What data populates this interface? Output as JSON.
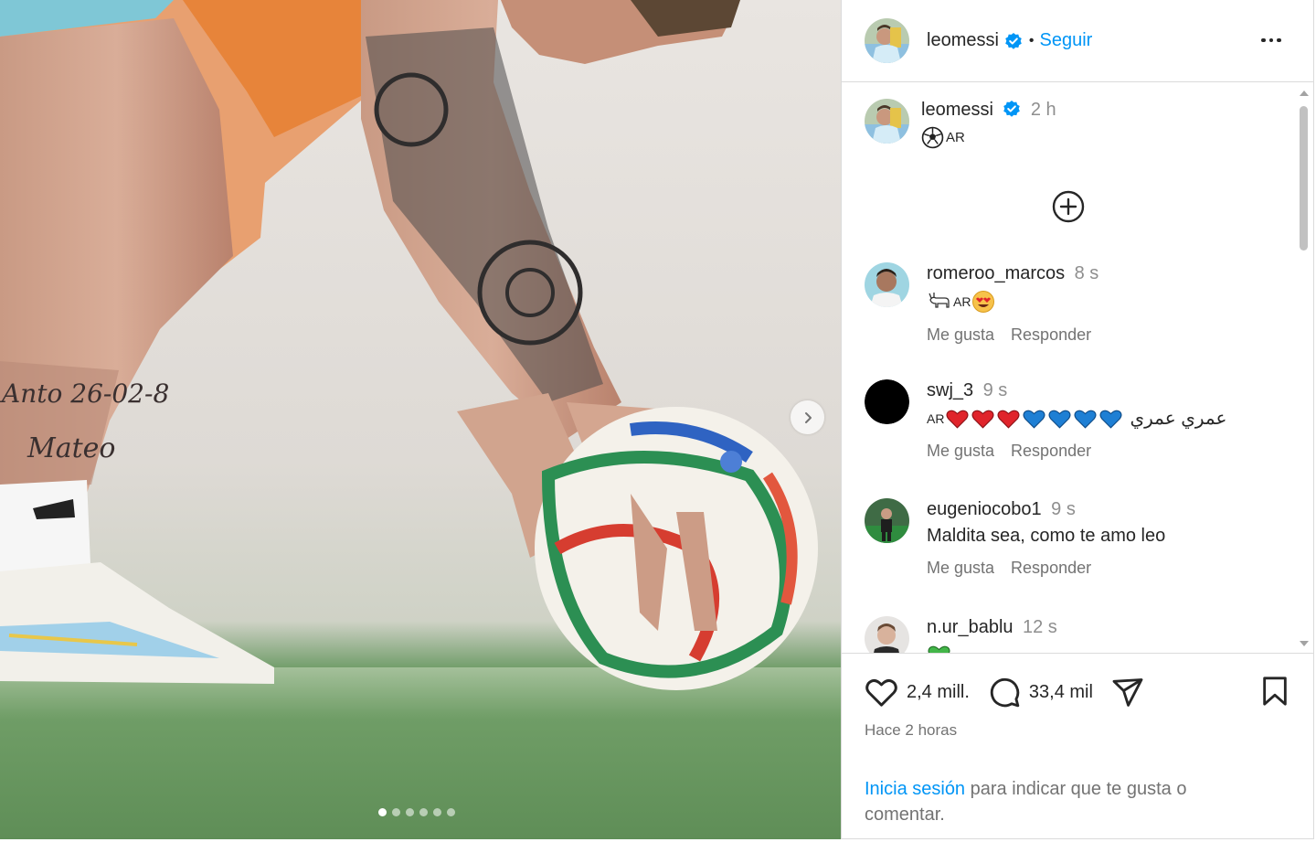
{
  "post": {
    "author": "leomessi",
    "follow_label": "Seguir",
    "separator": "•",
    "caption_time": "2 h",
    "caption_flag": "AR",
    "carousel": {
      "slides": 6,
      "active": 0
    }
  },
  "comments": [
    {
      "user": "romeroo_marcos",
      "time": "8 s",
      "text_flag": "AR",
      "like_label": "Me gusta",
      "reply_label": "Responder"
    },
    {
      "user": "swj_3",
      "time": "9 s",
      "text_flag": "AR",
      "text_arabic": "عمري عمري",
      "like_label": "Me gusta",
      "reply_label": "Responder"
    },
    {
      "user": "eugeniocobo1",
      "time": "9 s",
      "text": "Maldita sea, como te amo leo",
      "like_label": "Me gusta",
      "reply_label": "Responder"
    },
    {
      "user": "n.ur_bablu",
      "time": "12 s"
    }
  ],
  "actions": {
    "likes": "2,4 mill.",
    "comments": "33,4 mil",
    "posted": "Hace 2 horas",
    "login_link": "Inicia sesión",
    "login_rest": " para indicar que te gusta o comentar."
  },
  "icons": [
    "verified-badge-icon",
    "more-options-icon",
    "add-circle-icon",
    "heart-icon",
    "comment-icon",
    "share-icon",
    "bookmark-icon",
    "chevron-right-icon"
  ],
  "colors": {
    "link": "#0095f6",
    "verified": "#0095f6",
    "muted": "#737373",
    "border": "#dbdbdb",
    "heart_red": "#e0242b",
    "heart_blue": "#1e7fd4"
  }
}
